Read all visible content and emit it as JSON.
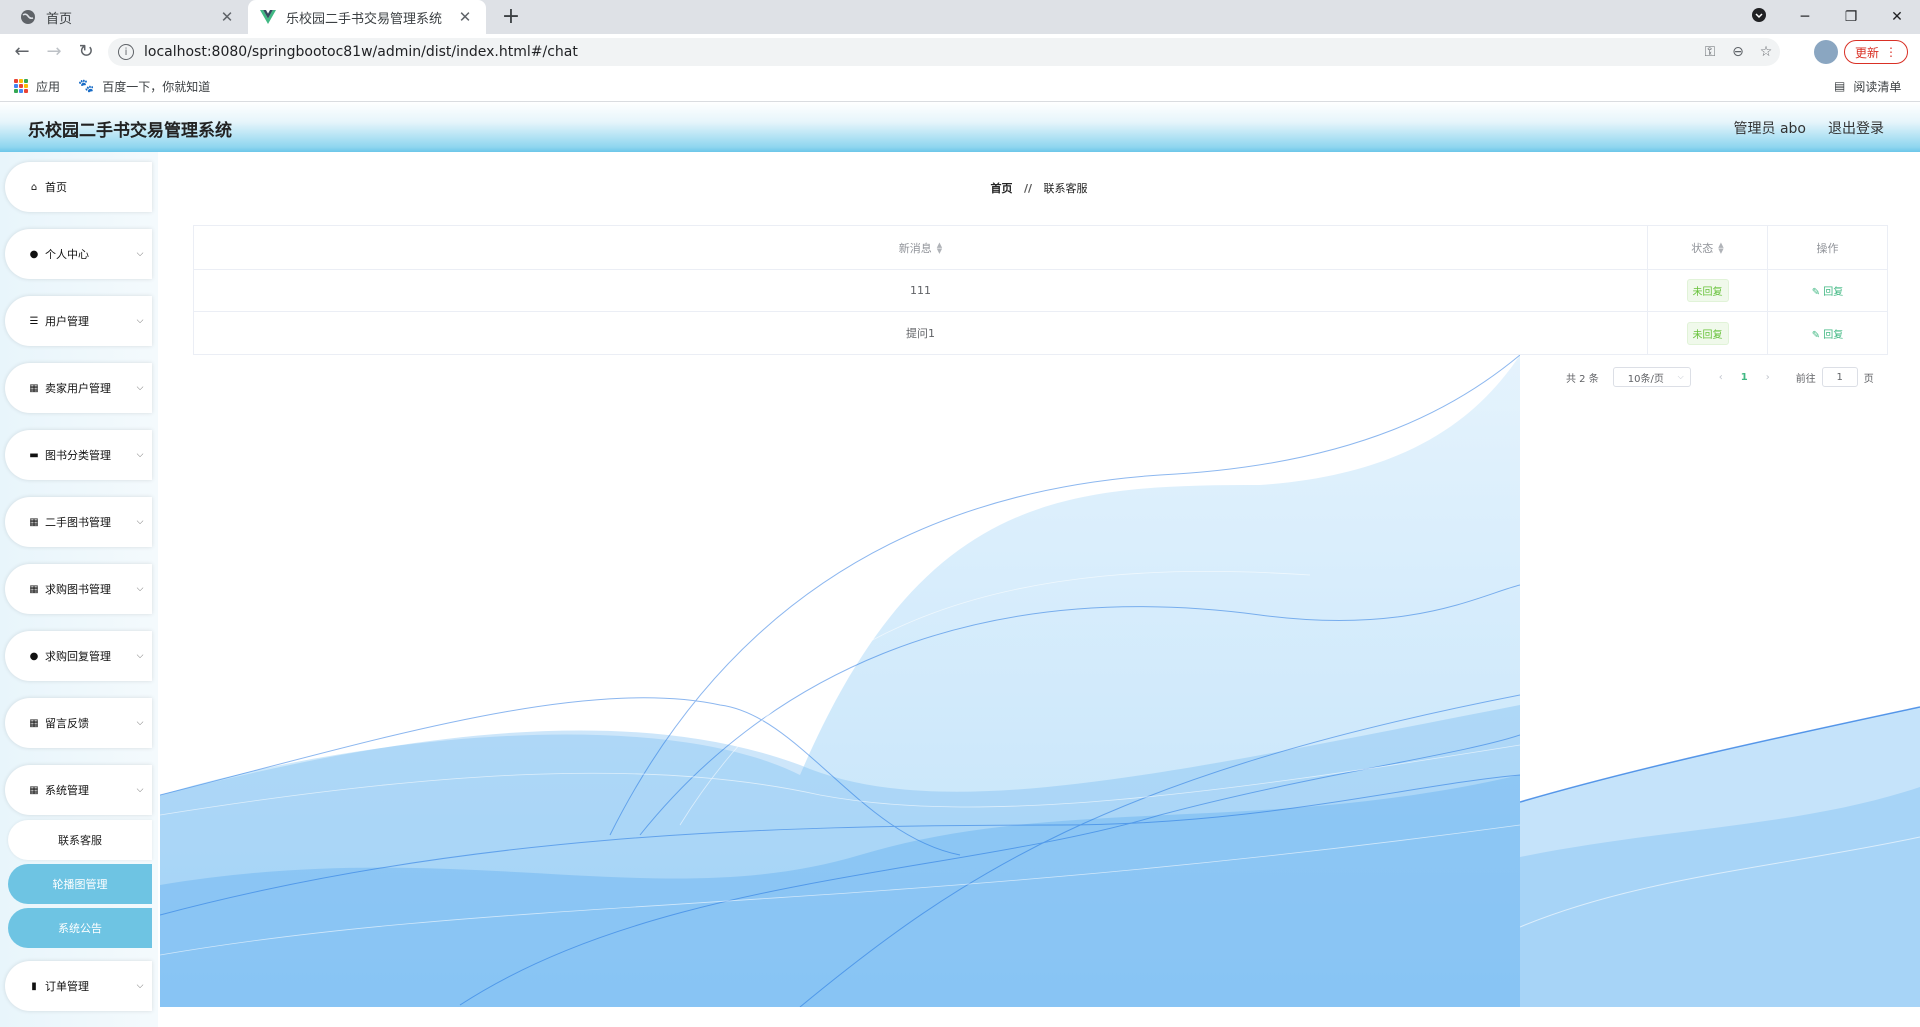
{
  "browser": {
    "tabs": [
      {
        "title": "首页",
        "active": false
      },
      {
        "title": "乐校园二手书交易管理系统",
        "active": true
      }
    ],
    "url": "localhost:8080/springbootoc81w/admin/dist/index.html#/chat",
    "update_label": "更新",
    "bookmarks": {
      "apps": "应用",
      "baidu": "百度一下，你就知道",
      "reading_list": "阅读清单"
    }
  },
  "header": {
    "title": "乐校园二手书交易管理系统",
    "user": "管理员 abo",
    "logout": "退出登录"
  },
  "sidebar": {
    "items": [
      {
        "label": "首页",
        "icon": "home-icon"
      },
      {
        "label": "个人中心",
        "icon": "user-icon"
      },
      {
        "label": "用户管理",
        "icon": "sliders-icon"
      },
      {
        "label": "卖家用户管理",
        "icon": "grid-icon"
      },
      {
        "label": "图书分类管理",
        "icon": "briefcase-icon"
      },
      {
        "label": "二手图书管理",
        "icon": "grid-icon"
      },
      {
        "label": "求购图书管理",
        "icon": "grid-icon"
      },
      {
        "label": "求购回复管理",
        "icon": "user-icon"
      },
      {
        "label": "留言反馈",
        "icon": "grid-icon"
      },
      {
        "label": "系统管理",
        "icon": "grid-icon"
      }
    ],
    "system_sub": [
      "联系客服",
      "轮播图管理",
      "系统公告"
    ],
    "last_item": {
      "label": "订单管理",
      "icon": "bar-chart-icon"
    }
  },
  "breadcrumb": {
    "home": "首页",
    "separator": "//",
    "current": "联系客服"
  },
  "table": {
    "headers": [
      "新消息",
      "状态",
      "操作"
    ],
    "rows": [
      {
        "message": "111",
        "status": "未回复",
        "action": "回复"
      },
      {
        "message": "提问1",
        "status": "未回复",
        "action": "回复"
      }
    ]
  },
  "pagination": {
    "total": "共 2 条",
    "page_size": "10条/页",
    "current_page": "1",
    "goto_label": "前往",
    "goto_value": "1",
    "page_suffix": "页"
  },
  "colors": {
    "accent": "#41b883",
    "sidebar_active": "#6ec4e3",
    "header_gradient_end": "#6cc6e9",
    "tag_green": "#67c23a"
  }
}
